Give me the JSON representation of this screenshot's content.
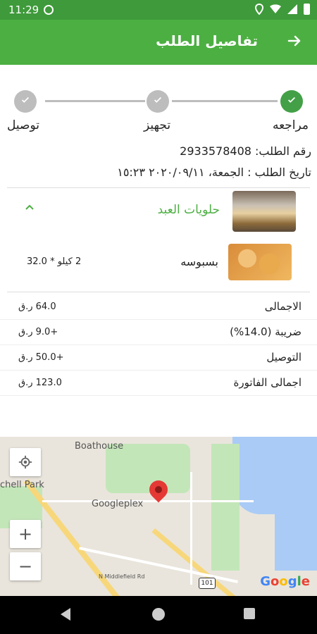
{
  "status_bar": {
    "time": "11:29"
  },
  "app_bar": {
    "title": "تفاصيل الطلب",
    "back_icon": "arrow-right-icon"
  },
  "stepper": {
    "steps": [
      {
        "label": "مراجعه",
        "state": "done"
      },
      {
        "label": "تجهيز",
        "state": "pending"
      },
      {
        "label": "توصيل",
        "state": "pending"
      }
    ]
  },
  "order": {
    "number": "رقم الطلب: 2933578408",
    "date": "تاريخ الطلب : الجمعة، ٢٠٢٠/٠٩/١١ ١٥:٢٣"
  },
  "store": {
    "name": "حلويات العبد"
  },
  "item": {
    "name": "بسبوسه",
    "qty": "2 كيلو * 32.0"
  },
  "summary": [
    {
      "label": "الاجمالى",
      "value": "64.0 ر.ق"
    },
    {
      "label": "ضريبة (14.0%)",
      "value": "+9.0 ر.ق"
    },
    {
      "label": "التوصيل",
      "value": "+50.0 ر.ق"
    },
    {
      "label": "اجمالى الفاتورة",
      "value": "123.0 ر.ق"
    }
  ],
  "map": {
    "labels": {
      "boathouse": "Boathouse",
      "park": "chell Park",
      "place": "Googleplex",
      "street": "N Shoreline Blvd",
      "road": "N Middlefield Rd",
      "route": "101"
    },
    "logo": "Google",
    "zoom_in": "+",
    "zoom_out": "−"
  },
  "colors": {
    "primary": "#4caf42",
    "status_bar": "#3e9a3a",
    "step_done": "#43a047",
    "step_pending": "#bdbdbd"
  }
}
